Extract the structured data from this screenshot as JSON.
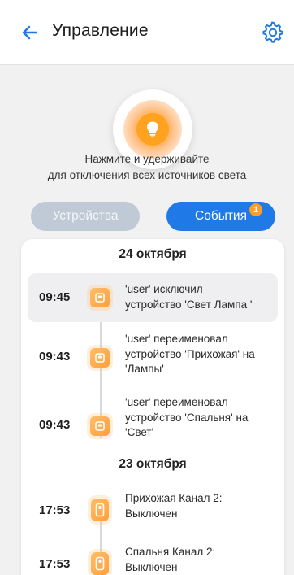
{
  "header": {
    "title": "Управление"
  },
  "hint": {
    "line1": "Нажмите и удерживайте",
    "line2": "для отключения всех источников света"
  },
  "tabs": {
    "devices": "Устройства",
    "events": "События",
    "events_badge": "1"
  },
  "groups": [
    {
      "date": "24 октября",
      "events": [
        {
          "time": "09:45",
          "text_line1": "'user' исключил",
          "text_line2": "устройство 'Свет Лампа '",
          "text_line3": "",
          "highlighted": true,
          "icon": "lamp-device-icon"
        },
        {
          "time": "09:43",
          "text_line1": "'user' переименовал",
          "text_line2": "устройство 'Прихожая' на",
          "text_line3": "'Лампы'",
          "highlighted": false,
          "icon": "lamp-device-icon"
        },
        {
          "time": "09:43",
          "text_line1": "'user' переименовал",
          "text_line2": "устройство 'Спальня' на",
          "text_line3": "'Свет'",
          "highlighted": false,
          "icon": "lamp-device-icon"
        }
      ]
    },
    {
      "date": "23 октября",
      "events": [
        {
          "time": "17:53",
          "text_line1": "Прихожая Канал 2:",
          "text_line2": "Выключен",
          "text_line3": "",
          "highlighted": false,
          "icon": "switch-icon"
        },
        {
          "time": "17:53",
          "text_line1": "Спальня Канал 2:",
          "text_line2": "Выключен",
          "text_line3": "",
          "highlighted": false,
          "icon": "switch-icon"
        }
      ]
    }
  ],
  "colors": {
    "accent": "#1f79e6",
    "inactive_tab": "#bfcad6",
    "orange": "#ff9f3a"
  }
}
